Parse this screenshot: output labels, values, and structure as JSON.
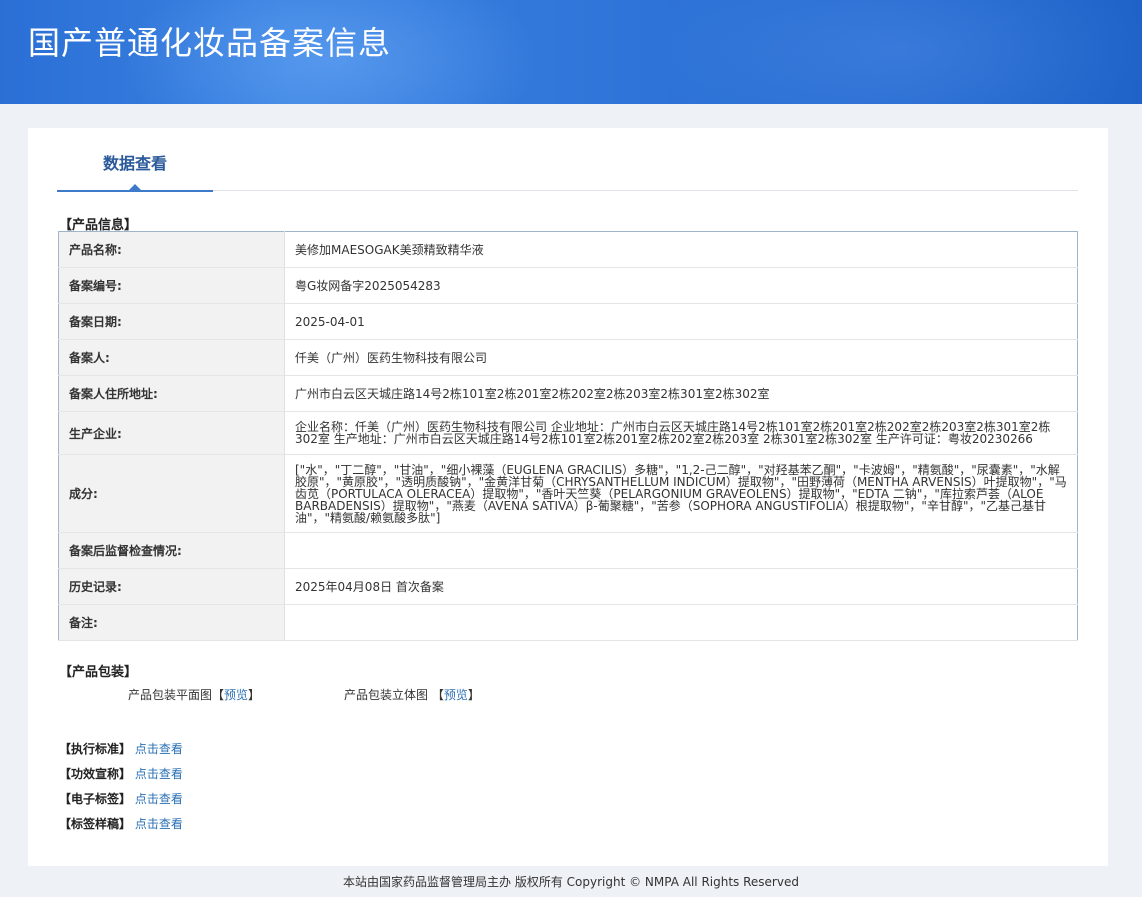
{
  "header": {
    "title": "国产普通化妆品备案信息"
  },
  "tabs": [
    {
      "label": "数据查看"
    }
  ],
  "product_info": {
    "section_title": "【产品信息】",
    "rows": [
      {
        "label": "产品名称:",
        "value": "美修加MAESOGAK美颈精致精华液"
      },
      {
        "label": "备案编号:",
        "value": "粤G妆网备字2025054283"
      },
      {
        "label": "备案日期:",
        "value": "2025-04-01"
      },
      {
        "label": "备案人:",
        "value": "仟美（广州）医药生物科技有限公司"
      },
      {
        "label": "备案人住所地址:",
        "value": "广州市白云区天城庄路14号2栋101室2栋201室2栋202室2栋203室2栋301室2栋302室"
      },
      {
        "label": "生产企业:",
        "value": "企业名称：仟美（广州）医药生物科技有限公司 企业地址：广州市白云区天城庄路14号2栋101室2栋201室2栋202室2栋203室2栋301室2栋302室 生产地址：广州市白云区天城庄路14号2栋101室2栋201室2栋202室2栋203室 2栋301室2栋302室 生产许可证：粤妆20230266"
      },
      {
        "label": "成分:",
        "value": "[\"水\"，\"丁二醇\"，\"甘油\"，\"细小裸藻（EUGLENA GRACILIS）多糖\"，\"1,2-己二醇\"，\"对羟基苯乙酮\"，\"卡波姆\"，\"精氨酸\"，\"尿囊素\"，\"水解胶原\"，\"黄原胶\"，\"透明质酸钠\"，\"金黄洋甘菊（CHRYSANTHELLUM INDICUM）提取物\"，\"田野薄荷（MENTHA ARVENSIS）叶提取物\"，\"马齿苋（PORTULACA OLERACEA）提取物\"，\"香叶天竺葵（PELARGONIUM GRAVEOLENS）提取物\"，\"EDTA 二钠\"，\"库拉索芦荟（ALOE BARBADENSIS）提取物\"，\"燕麦（AVENA SATIVA）β-葡聚糖\"，\"苦参（SOPHORA ANGUSTIFOLIA）根提取物\"，\"辛甘醇\"，\"乙基己基甘油\"，\"精氨酸/赖氨酸多肽\"]"
      },
      {
        "label": "备案后监督检查情况:",
        "value": ""
      },
      {
        "label": "历史记录:",
        "value": "2025年04月08日 首次备案"
      },
      {
        "label": "备注:",
        "value": ""
      }
    ]
  },
  "packaging": {
    "section_title": "【产品包装】",
    "flat_label": "产品包装平面图",
    "flat_bracket_open": "【",
    "flat_link": "预览",
    "flat_bracket_close": "】",
    "solid_label": "产品包装立体图",
    "solid_bracket_open": "【",
    "solid_link": "预览",
    "solid_bracket_close": "】"
  },
  "links": [
    {
      "label": "【执行标准】",
      "link": "点击查看"
    },
    {
      "label": "【功效宣称】",
      "link": "点击查看"
    },
    {
      "label": "【电子标签】",
      "link": "点击查看"
    },
    {
      "label": "【标签样稿】",
      "link": "点击查看"
    }
  ],
  "footer": {
    "text": "本站由国家药品监督管理局主办 版权所有 Copyright © NMPA All Rights Reserved"
  }
}
